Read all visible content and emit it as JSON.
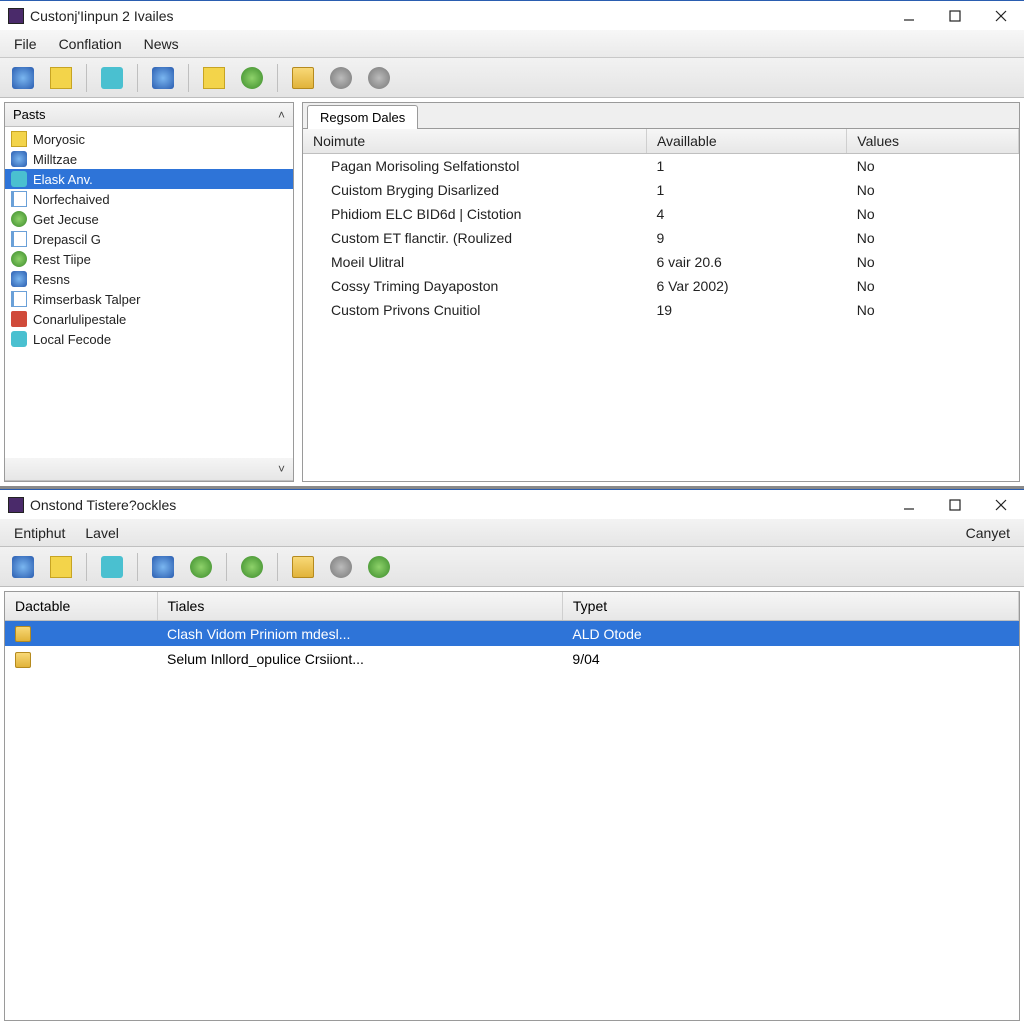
{
  "window1": {
    "title": "Custonj'Iinpun 2 Ivailes",
    "menus": [
      "File",
      "Conflation",
      "News"
    ],
    "sidebar": {
      "header": "Pasts",
      "items": [
        {
          "label": "Moryosic",
          "icon": "i-yellow"
        },
        {
          "label": "Milltzae",
          "icon": "i-blue"
        },
        {
          "label": "Elask Anv.",
          "icon": "i-cyan",
          "selected": true
        },
        {
          "label": "Norfechaived",
          "icon": "i-doc"
        },
        {
          "label": "Get Jecuse",
          "icon": "i-green"
        },
        {
          "label": "Drepascil G",
          "icon": "i-doc"
        },
        {
          "label": "Rest Tiipe",
          "icon": "i-green"
        },
        {
          "label": "Resns",
          "icon": "i-blue"
        },
        {
          "label": "Rimserbask Talper",
          "icon": "i-doc"
        },
        {
          "label": "Conarlulipestale",
          "icon": "i-red"
        },
        {
          "label": "Local Fecode",
          "icon": "i-cyan"
        }
      ]
    },
    "main": {
      "tab": "Regsom Dales",
      "columns": [
        "Noimute",
        "Availlable",
        "Values"
      ],
      "rows": [
        {
          "c0": "Pagan Morisoling Selfationstol",
          "c1": "1",
          "c2": "No"
        },
        {
          "c0": "Cuistom Bryging Disarlized",
          "c1": "1",
          "c2": "No"
        },
        {
          "c0": "Phidiom ELC BID6d | Cistotion",
          "c1": "4",
          "c2": "No"
        },
        {
          "c0": "Custom ET flanctir. (Roulized",
          "c1": "9",
          "c2": "No"
        },
        {
          "c0": "Moeil Ulitral",
          "c1": "6 vair 20.6",
          "c2": "No"
        },
        {
          "c0": "Cossy Triming Dayaposton",
          "c1": "6 Var 2002)",
          "c2": "No"
        },
        {
          "c0": "Custom Privons Cnuitiol",
          "c1": "19",
          "c2": "No"
        }
      ]
    }
  },
  "window2": {
    "title": "Onstond Tistere?ockles",
    "menus": [
      "Entiphut",
      "Lavel"
    ],
    "right_btn": "Canyet",
    "columns": [
      "Dactable",
      "Tiales",
      "Typet"
    ],
    "rows": [
      {
        "c0": "",
        "c1": "Clash Vidom Priniom mdesl...",
        "c2": "ALD Otode",
        "selected": true
      },
      {
        "c0": "",
        "c1": "Selum Inllord_opulice Crsiiont...",
        "c2": "9/04"
      }
    ]
  }
}
